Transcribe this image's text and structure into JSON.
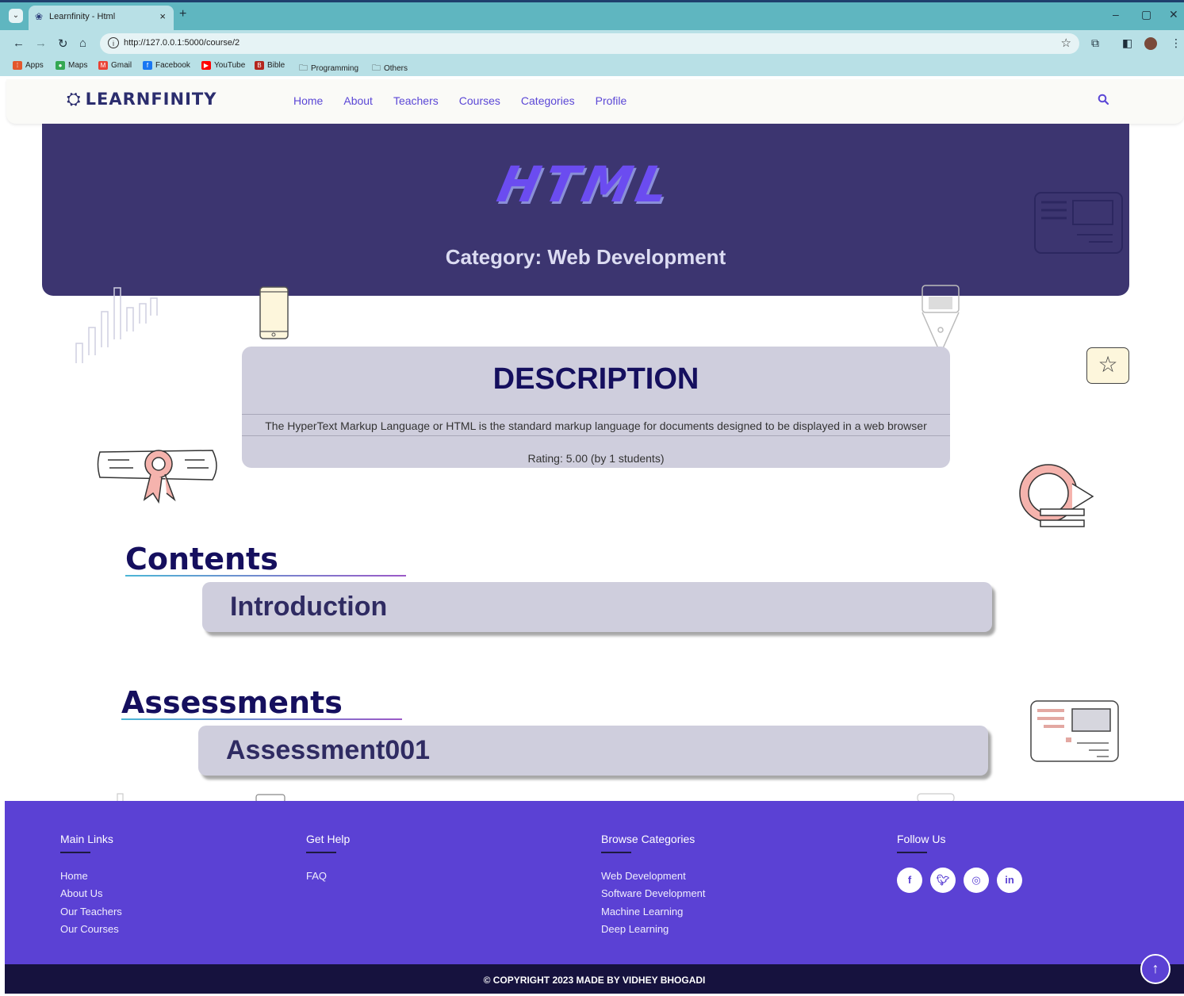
{
  "browser": {
    "tab_title": "Learnfinity - Html",
    "url": "http://127.0.0.1:5000/course/2",
    "bookmarks": [
      "Apps",
      "Maps",
      "Gmail",
      "Facebook",
      "YouTube",
      "Bible",
      "Programming",
      "Others"
    ]
  },
  "site": {
    "logo_text": "LEARNFINITY",
    "nav": [
      "Home",
      "About",
      "Teachers",
      "Courses",
      "Categories",
      "Profile"
    ]
  },
  "course": {
    "title": "HTML",
    "category": "Category: Web Development",
    "description_heading": "DESCRIPTION",
    "description": "The HyperText Markup Language or HTML is the standard markup language for documents designed to be displayed in a web browser",
    "rating": "Rating: 5.00 (by 1 students)"
  },
  "contents": {
    "heading": "Contents",
    "items": [
      "Introduction"
    ]
  },
  "assessments": {
    "heading": "Assessments",
    "items": [
      "Assessment001"
    ]
  },
  "footer": {
    "main_links": {
      "heading": "Main Links",
      "links": [
        "Home",
        "About Us",
        "Our Teachers",
        "Our Courses"
      ]
    },
    "get_help": {
      "heading": "Get Help",
      "links": [
        "FAQ"
      ]
    },
    "browse_categories": {
      "heading": "Browse Categories",
      "links": [
        "Web Development",
        "Software Development",
        "Machine Learning",
        "Deep Learning"
      ]
    },
    "follow_us": {
      "heading": "Follow Us",
      "icons": [
        "facebook-icon",
        "twitter-icon",
        "instagram-icon",
        "linkedin-icon"
      ]
    },
    "copyright": "© COPYRIGHT 2023 MADE BY VIDHEY BHOGADI"
  },
  "colors": {
    "accent": "#5b41d4",
    "hero": "#3c3570",
    "card": "#cfcedd",
    "heading": "#150f5e"
  }
}
